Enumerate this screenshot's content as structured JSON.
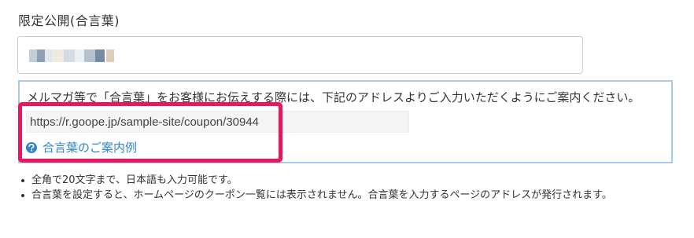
{
  "section": {
    "label": "限定公開(合言葉)"
  },
  "passphrase_input": {
    "value_state": "obscured",
    "blur_colors": [
      "#b8c4d4",
      "#7d8ea6",
      "#dde3ea",
      "#f1e6d8",
      "#c9d6e2",
      "#e8edf2",
      "#a7b6c8",
      "#5f7590",
      "#d8c6aa"
    ]
  },
  "info": {
    "text": "メルマガ等で「合言葉」をお客様にお伝えする際には、下記のアドレスよりご入力いただくようにご案内ください。",
    "url": "https://r.goope.jp/sample-site/coupon/30944",
    "example_link": "合言葉のご案内例"
  },
  "notes": [
    "全角で20文字まで、日本語も入力可能です。",
    "合言葉を設定すると、ホームページのクーポン一覧には表示されません。合言葉を入力するページのアドレスが発行されます。"
  ],
  "colors": {
    "highlight": "#e6185f",
    "link": "#2f86c8",
    "info_border": "#a6cbeb"
  },
  "icons": {
    "help": "question-circle-icon"
  }
}
